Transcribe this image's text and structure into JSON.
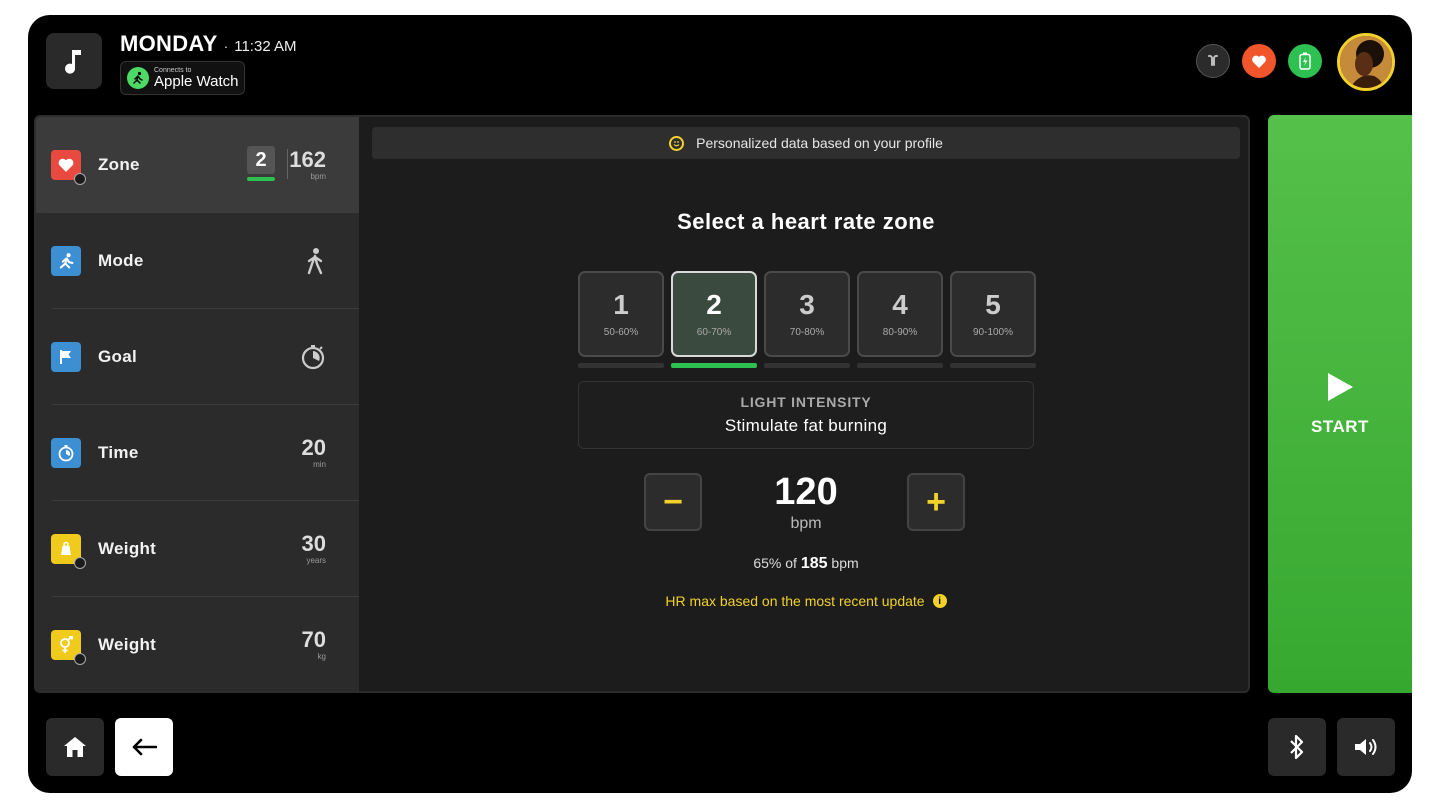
{
  "header": {
    "day": "MONDAY",
    "separator": "·",
    "time": "11:32 AM",
    "watch_small": "Connects to",
    "watch_big": "Apple Watch"
  },
  "sidebar": {
    "items": [
      {
        "label": "Zone",
        "zone_chip": "2",
        "value": "162",
        "unit": "bpm",
        "icon": "heart-icon",
        "color": "#e94a3f"
      },
      {
        "label": "Mode",
        "icon": "walking-person-icon",
        "color": "#3d8fd4"
      },
      {
        "label": "Goal",
        "icon": "flag-icon",
        "color": "#3d8fd4"
      },
      {
        "label": "Time",
        "value": "20",
        "unit": "min",
        "icon": "stopwatch-icon",
        "color": "#3d8fd4"
      },
      {
        "label": "Weight",
        "value": "30",
        "unit": "years",
        "icon": "weight-icon",
        "color": "#f1cb1c"
      },
      {
        "label": "Weight",
        "value": "70",
        "unit": "kg",
        "icon": "gender-icon",
        "color": "#f1cb1c"
      }
    ]
  },
  "main": {
    "banner": "Personalized data based on your profile",
    "heading": "Select a heart rate zone",
    "zones": [
      {
        "num": "1",
        "range": "50-60%"
      },
      {
        "num": "2",
        "range": "60-70%",
        "selected": true
      },
      {
        "num": "3",
        "range": "70-80%"
      },
      {
        "num": "4",
        "range": "80-90%"
      },
      {
        "num": "5",
        "range": "90-100%"
      }
    ],
    "intensity_title": "LIGHT INTENSITY",
    "intensity_desc": "Stimulate fat burning",
    "minus": "−",
    "plus": "+",
    "bpm_value": "120",
    "bpm_unit": "bpm",
    "pct_prefix": "65% of",
    "pct_max": "185",
    "pct_unit": "bpm",
    "hr_note": "HR max based on the most recent update",
    "info_glyph": "i"
  },
  "start": {
    "label": "START"
  },
  "colors": {
    "accent_green": "#2ec050",
    "accent_yellow": "#f2d22a",
    "heart_orange": "#f0552c"
  }
}
